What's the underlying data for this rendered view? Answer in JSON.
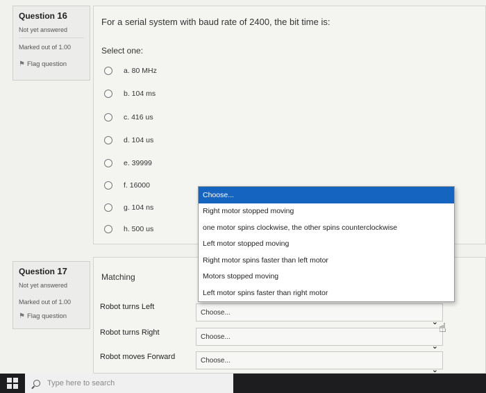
{
  "q16": {
    "number_prefix": "Question",
    "number": "16",
    "state": "Not yet answered",
    "grade": "Marked out of 1.00",
    "flag": "Flag question",
    "text": "For a serial system with baud rate of 2400, the bit time is:",
    "prompt": "Select one:",
    "options": [
      "a. 80 MHz",
      "b. 104 ms",
      "c. 416 us",
      "d. 104 us",
      "e. 39999",
      "f. 16000",
      "g. 104 ns",
      "h. 500 us"
    ]
  },
  "q17": {
    "number_prefix": "Question",
    "number": "17",
    "state": "Not yet answered",
    "grade": "Marked out of 1.00",
    "flag": "Flag question",
    "text": "Matching",
    "rows": [
      {
        "label": "Robot turns Left",
        "value": "Choose..."
      },
      {
        "label": "Robot turns Right",
        "value": "Choose..."
      },
      {
        "label": "Robot moves Forward",
        "value": "Choose..."
      }
    ]
  },
  "dropdown": {
    "items": [
      "Choose...",
      "Right motor stopped moving",
      "one motor spins clockwise, the other spins counterclockwise",
      "Left motor stopped moving",
      "Right motor spins faster than left motor",
      "Motors stopped moving",
      "Left motor spins faster than right motor"
    ]
  },
  "taskbar": {
    "search_placeholder": "Type here to search"
  },
  "colors": {
    "selected_option": "#1565c0"
  }
}
